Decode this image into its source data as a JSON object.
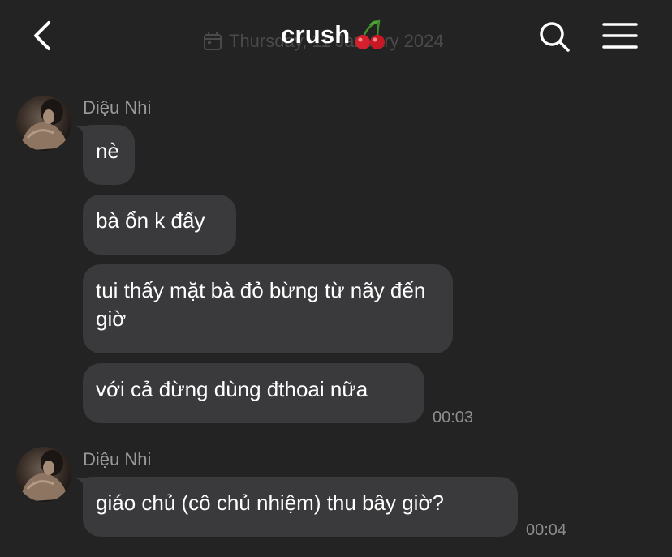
{
  "header": {
    "back_icon": "chevron-left-icon",
    "title": "crush",
    "title_emoji": "🍒",
    "date_banner": "Thursday, 11 January 2024",
    "search_icon": "search-icon",
    "menu_icon": "hamburger-menu-icon"
  },
  "groups": [
    {
      "sender": "Diệu Nhi",
      "messages": [
        "nè",
        "bà ổn k đấy",
        "tui thấy mặt bà đỏ bừng từ nãy đến giờ",
        "với cả đừng dùng đthoai nữa"
      ],
      "time": "00:03"
    },
    {
      "sender": "Diệu Nhi",
      "messages": [
        "giáo chủ (cô chủ nhiệm) thu bây giờ?"
      ],
      "time": "00:04"
    }
  ],
  "colors": {
    "background": "#232323",
    "bubble": "#3a3a3c",
    "sender_text": "#9a9a9a",
    "time_text": "#8d8d8d"
  }
}
